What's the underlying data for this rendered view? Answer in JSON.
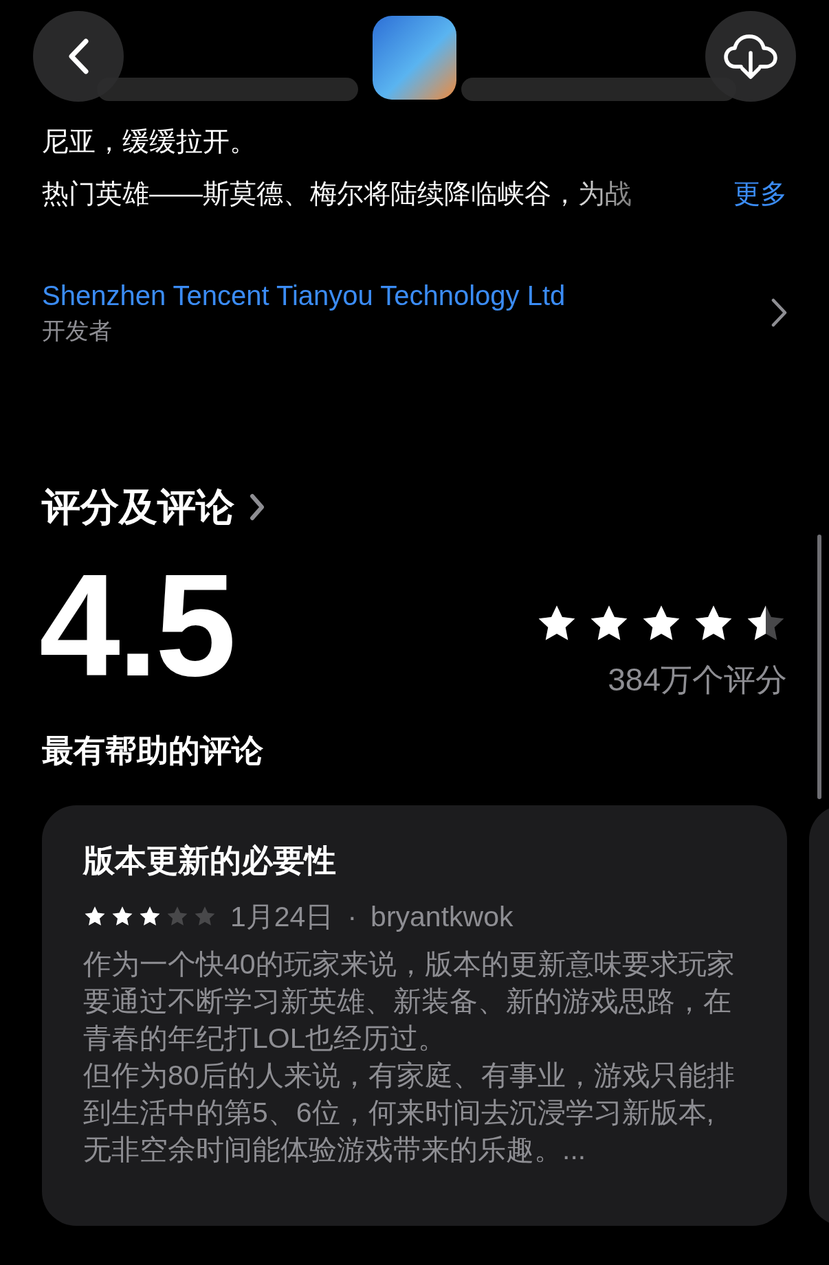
{
  "description": {
    "lines": [
      "尼亚，缓缓拉开。",
      "热门英雄——斯莫德、梅尔将陆续降临峡谷，为战"
    ],
    "more_link": "更多"
  },
  "developer": {
    "name": "Shenzhen Tencent Tianyou Technology Ltd",
    "label": "开发者"
  },
  "ratings": {
    "heading": "评分及评论",
    "score": "4.5",
    "stars": 4.5,
    "count": "384万个评分"
  },
  "reviews": {
    "heading": "最有帮助的评论",
    "items": [
      {
        "title": "版本更新的必要性",
        "stars": 3,
        "date": "1月24日",
        "separator": "·",
        "author": "bryantkwok",
        "paragraphs": [
          "作为一个快40的玩家来说，版本的更新意味要求玩家要通过不断学习新英雄、新装备、新的游戏思路，在青春的年纪打LOL也经历过。",
          "但作为80后的人来说，有家庭、有事业，游戏只能排到生活中的第5、6位，何来时间去沉浸学习新版本, 无非空余时间能体验游戏带来的乐趣。..."
        ]
      }
    ]
  }
}
